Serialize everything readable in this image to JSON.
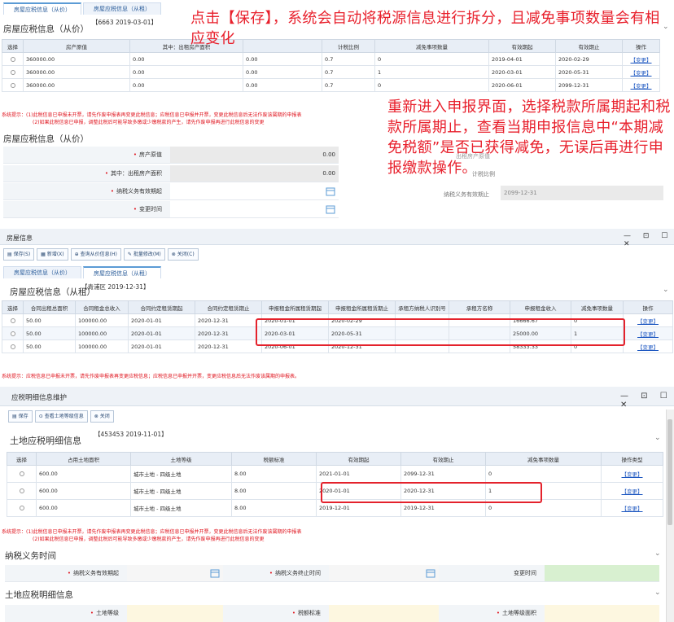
{
  "panel1": {
    "tabs": [
      "房屋应税信息（从价）",
      "房屋应税信息（从租）"
    ],
    "stamp": "【6663 2019-03-01】",
    "section_title": "房屋应税信息（从价）",
    "headers": [
      "选择",
      "房产原值",
      "其中：出租房产面积",
      "",
      "计税比例",
      "减免事项数量",
      "有效期起",
      "有效期止",
      "操作"
    ],
    "rows": [
      {
        "original": "360000.00",
        "rent_area": "0.00",
        "c3": "0.00",
        "ratio": "0.7",
        "relief": "0",
        "start": "2019-04-01",
        "end": "2020-02-29",
        "op": "【变更】"
      },
      {
        "original": "360000.00",
        "rent_area": "0.00",
        "c3": "0.00",
        "ratio": "0.7",
        "relief": "1",
        "start": "2020-03-01",
        "end": "2020-05-31",
        "op": "【变更】"
      },
      {
        "original": "360000.00",
        "rent_area": "0.00",
        "c3": "0.00",
        "ratio": "0.7",
        "relief": "0",
        "start": "2020-06-01",
        "end": "2099-12-31",
        "op": "【变更】"
      }
    ],
    "warning1": "系统提示：(1)此税信息已申报未开票，请先作废申报表再变更此税信息；应税信息已申报并开票，变更此税信息后无法作废该属期的申报表",
    "warning2": "(2)如果此税信息已申报，调整此税后可能导致多缴或少缴税款的产生，请先作废申报再进行此税信息的变更",
    "form_title": "房屋应税信息（从价）",
    "form": {
      "label1": "房产原值",
      "val1": "0.00",
      "label2": "其中：出租房产面积",
      "val2": "0.00",
      "label3": "纳税义务有效期起",
      "label4": "变更时间",
      "right_label1": "计税比例",
      "right_label2": "纳税义务有效期止",
      "right_val2": "2099-12-31",
      "right_label3": "出租房产原值"
    },
    "req_mark": "•"
  },
  "callouts": {
    "top": "点击【保存】，系统会自动将税源信息进行拆分，且减免事项数量会有相应变化",
    "mid": "重新进入申报界面，选择税款所属期起和税款所属期止，查看当期申报信息中“本期减免税额”是否已获得减免，无误后再进行申报缴款操作。"
  },
  "panel2": {
    "window_title": "房屋信息",
    "window_controls": "— ⊡ ☐ ✕",
    "toolbar": [
      "保存(S)",
      "新增(X)",
      "查询从价信息(H)",
      "批量修改(M)",
      "关闭(C)"
    ],
    "tabs": [
      "房屋应税信息（从价）",
      "房屋应税信息（从租）"
    ],
    "stamp": "【青浦区 2019-12-31】",
    "section_title": "房屋应税信息（从租）",
    "headers": [
      "选择",
      "合同出租总面积",
      "合同租金总收入",
      "合同约定租赁期起",
      "合同约定租赁期止",
      "申报租金所属租赁期起",
      "申报租金所属租赁期止",
      "承租方纳税人识别号",
      "承租方名称",
      "申报租金收入",
      "减免事项数量",
      "操作"
    ],
    "rows": [
      {
        "area": "50.00",
        "income": "100000.00",
        "cstart": "2020-01-01",
        "cend": "2020-12-31",
        "dstart": "2020-01-01",
        "dend": "2020-02-29",
        "tid": "",
        "tname": "",
        "rent": "16666.67",
        "relief": "0",
        "op": "【变更】"
      },
      {
        "area": "50.00",
        "income": "100000.00",
        "cstart": "2020-01-01",
        "cend": "2020-12-31",
        "dstart": "2020-03-01",
        "dend": "2020-05-31",
        "tid": "",
        "tname": "",
        "rent": "25000.00",
        "relief": "1",
        "op": "【变更】"
      },
      {
        "area": "50.00",
        "income": "100000.00",
        "cstart": "2020-01-01",
        "cend": "2020-12-31",
        "dstart": "2020-06-01",
        "dend": "2020-12-31",
        "tid": "",
        "tname": "",
        "rent": "58333.33",
        "relief": "0",
        "op": "【变更】"
      }
    ],
    "warning": "系统提示：应税信息已申报未开票，请先作废申报表再变更应税信息；应税信息已申报并开票，变更应税信息后无法作废该属期的申报表。"
  },
  "panel3": {
    "window_title": "应税明细信息维护",
    "window_controls": "— ⊡ ☐ ✕",
    "toolbar": [
      "保存",
      "查看土地等级信息",
      "关闭"
    ],
    "stamp": "【453453 2019-11-01】",
    "section_title": "土地应税明细信息",
    "headers": [
      "选择",
      "占用土地面积",
      "土地等级",
      "税额标准",
      "有效期起",
      "有效期止",
      "减免事项数量",
      "操作类型"
    ],
    "rows": [
      {
        "area": "600.00",
        "grade": "城市土地 - 四级土地",
        "std": "8.00",
        "start": "2021-01-01",
        "end": "2099-12-31",
        "relief": "0",
        "op": "【变更】"
      },
      {
        "area": "600.00",
        "grade": "城市土地 - 四级土地",
        "std": "8.00",
        "start": "2020-01-01",
        "end": "2020-12-31",
        "relief": "1",
        "op": "【变更】"
      },
      {
        "area": "600.00",
        "grade": "城市土地 - 四级土地",
        "std": "8.00",
        "start": "2019-12-01",
        "end": "2019-12-31",
        "relief": "0",
        "op": "【变更】"
      }
    ],
    "warning1": "系统提示：(1)此税信息已申报未开票，请先作废申报表再变更此税信息；应税信息已申报并开票，变更此税信息后无法作废该属期的申报表",
    "warning2": "(2)如果此税信息已申报，调整此税后可能导致多缴或少缴税款的产生，请先作废申报再进行此税信息的变更",
    "duty_title": "纳税义务时间",
    "duty_labels": [
      "纳税义务有效期起",
      "纳税义务终止时间",
      "变更时间"
    ],
    "detail_title": "土地应税明细信息",
    "detail_labels": [
      "土地等级",
      "税额标准",
      "土地等级面积"
    ]
  },
  "colors": {
    "accent": "#5b9bd5",
    "warning": "#e0141e",
    "highlight": "#e4222c",
    "header_bg": "#e8eef6"
  }
}
